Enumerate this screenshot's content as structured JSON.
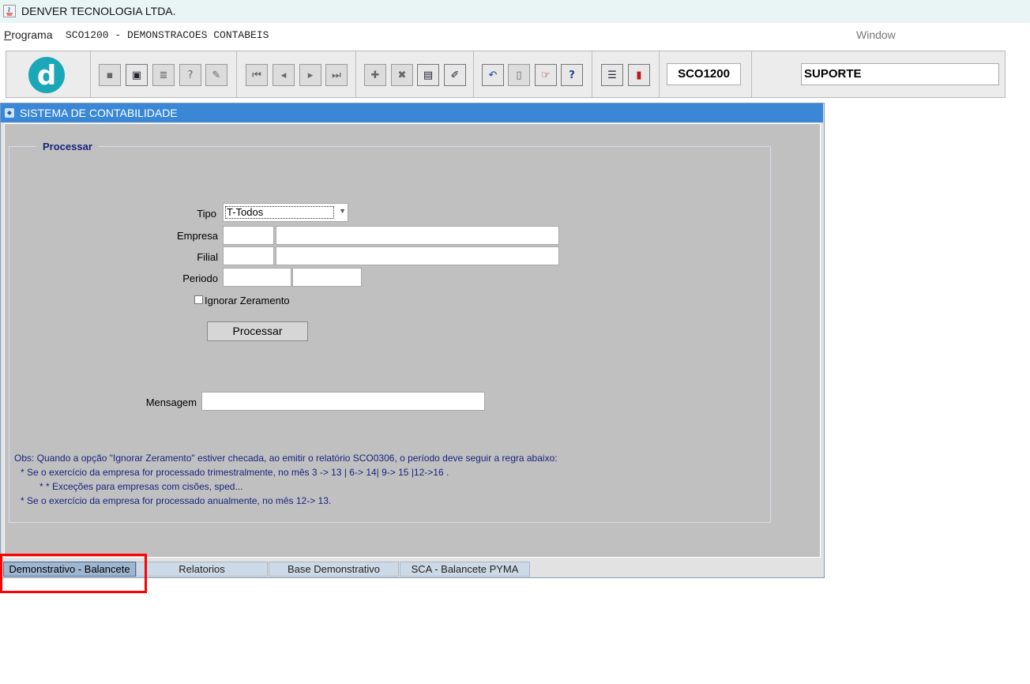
{
  "window": {
    "title": "DENVER TECNOLOGIA LTDA."
  },
  "menu": {
    "programa_first": "P",
    "programa_rest": "rograma",
    "program_code": "SCO1200 - DEMONSTRACOES CONTABEIS",
    "window": "Window"
  },
  "toolbar": {
    "logo_letter": "d",
    "program_id": "SCO1200",
    "user": "SUPORTE",
    "icons": [
      "save-icon",
      "window-icon",
      "print-icon",
      "query-icon",
      "edit-icon",
      "first-record-icon",
      "previous-record-icon",
      "next-record-icon",
      "last-record-icon",
      "insert-record-icon",
      "delete-record-icon",
      "list-icon",
      "clear-icon",
      "undo-icon",
      "copy-icon",
      "exit-icon",
      "help-icon",
      "menu-icon",
      "close-icon"
    ]
  },
  "form": {
    "title": "SISTEMA DE CONTABILIDADE",
    "group_title": "Processar",
    "tipo_label": "Tipo",
    "tipo_value": "T-Todos",
    "empresa_label": "Empresa",
    "filial_label": "Filial",
    "periodo_label": "Periodo",
    "ignorar_label": "Ignorar Zeramento",
    "ignorar_checked": false,
    "processar_button": "Processar",
    "mensagem_label": "Mensagem",
    "mensagem_value": ""
  },
  "obs": [
    "Obs: Quando a opção \"Ignorar Zeramento\" estiver checada, ao emitir o relatório SCO0306, o período deve seguir a regra abaixo:",
    "* Se o exercício da empresa for processado trimestralmente, no mês 3 -> 13 | 6-> 14| 9-> 15 |12->16 .",
    "* *  Exceções para empresas com cisões, sped...",
    "* Se o exercício da empresa for processado anualmente, no mês 12-> 13."
  ],
  "tabs": [
    {
      "label": "Demonstrativo - Balancete",
      "active": true
    },
    {
      "label": "Relatorios",
      "active": false
    },
    {
      "label": "Base Demonstrativo",
      "active": false
    },
    {
      "label": "SCA - Balancete PYMA",
      "active": false
    }
  ],
  "colors": {
    "title_bar": "#3a87d6",
    "canvas": "#c0c0c0",
    "highlight": "#ff0000",
    "label_blue": "#1a237e"
  }
}
